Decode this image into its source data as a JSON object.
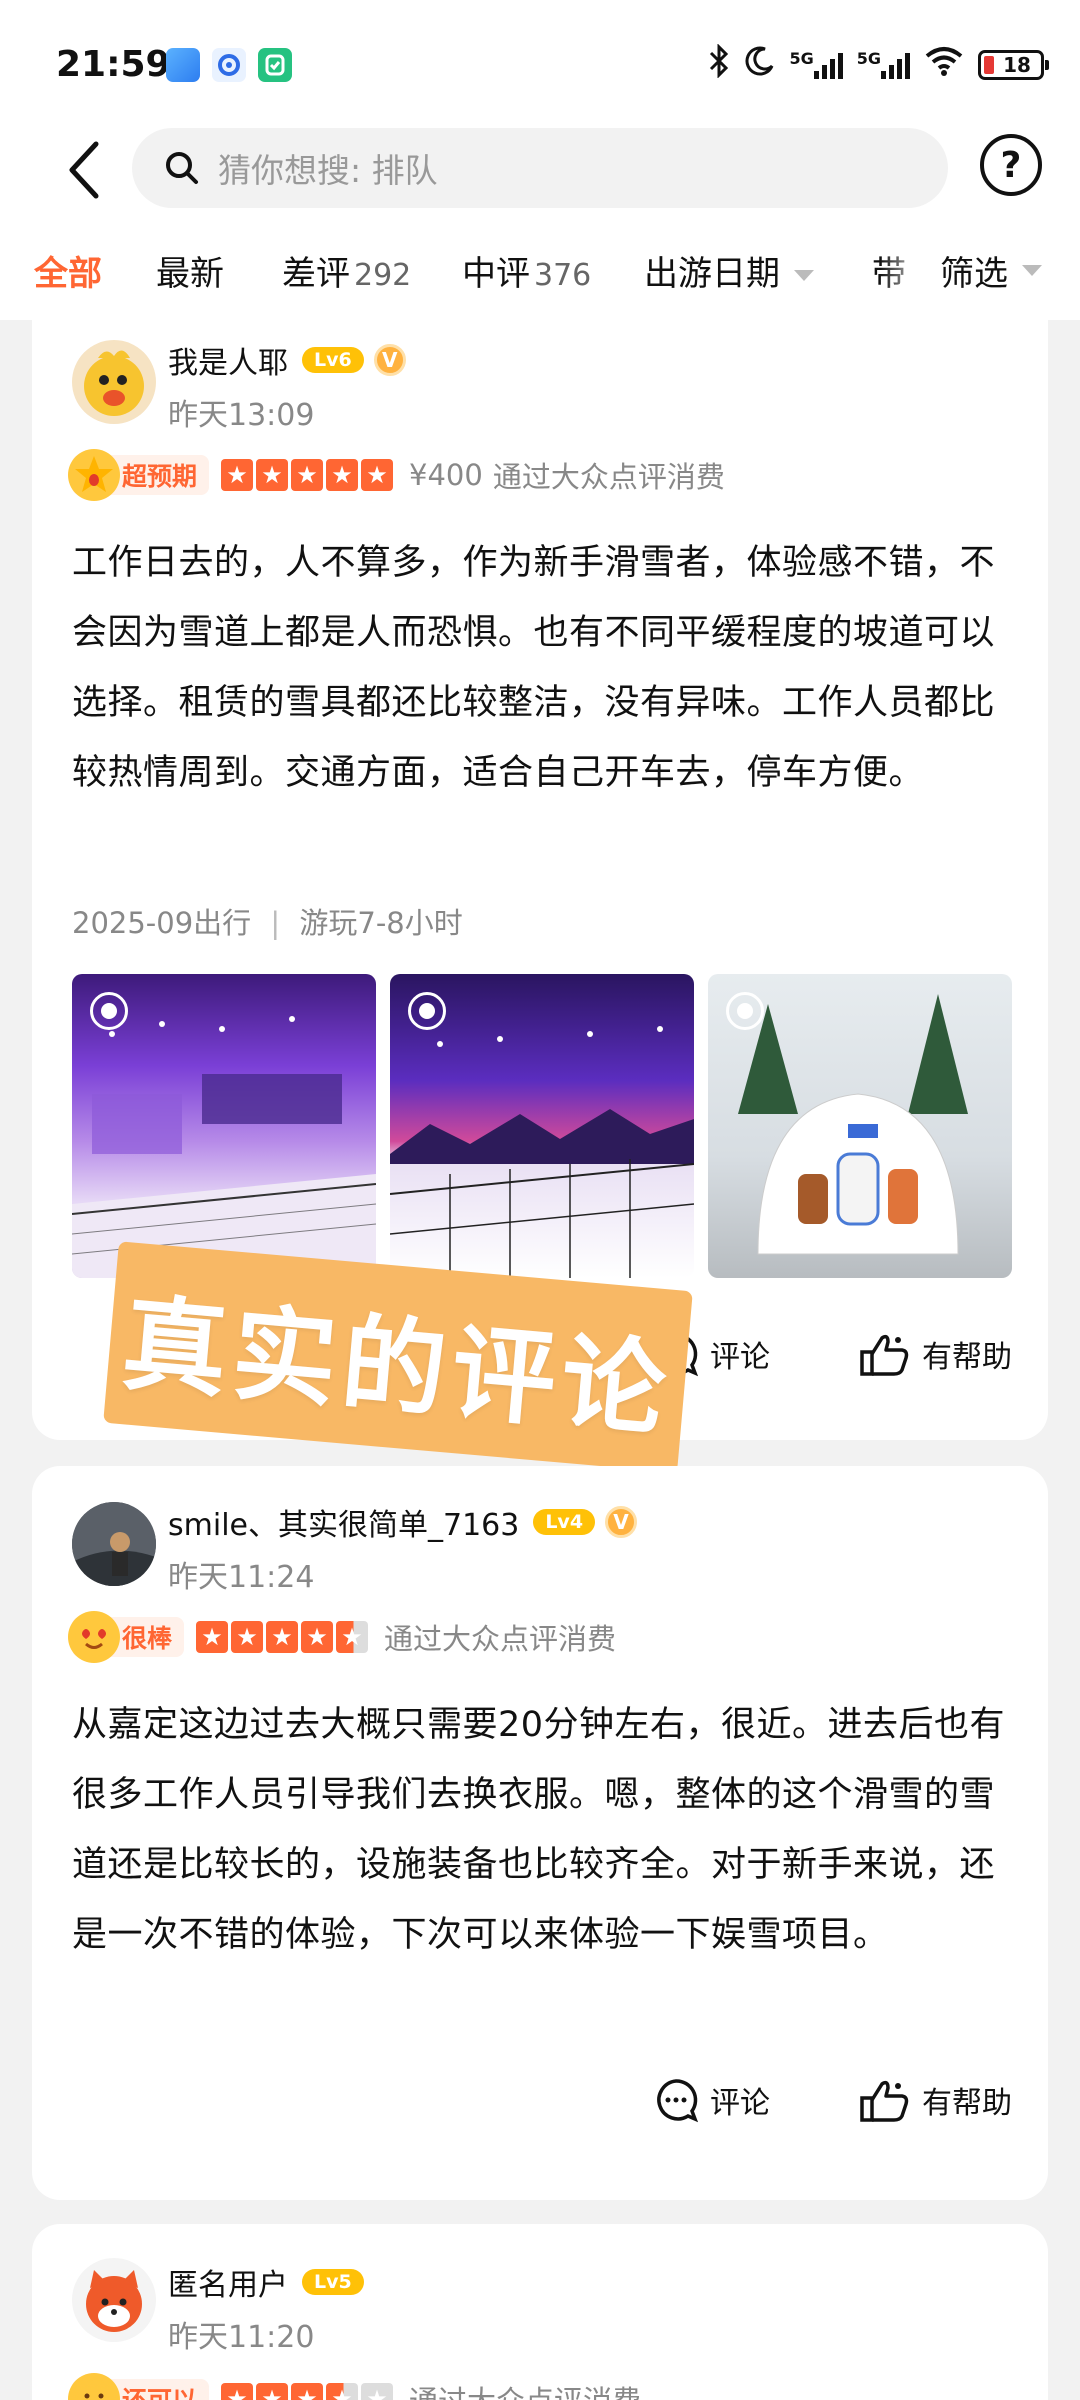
{
  "status_bar": {
    "time": "21:59",
    "network_1": "5G",
    "network_2": "5G",
    "battery": "18"
  },
  "header": {
    "search_placeholder": "猜你想搜: 排队",
    "help_label": "?"
  },
  "tabs": [
    {
      "label": "全部",
      "count": ""
    },
    {
      "label": "最新",
      "count": ""
    },
    {
      "label": "差评",
      "count": "292"
    },
    {
      "label": "中评",
      "count": "376"
    },
    {
      "label": "出游日期",
      "count": ""
    },
    {
      "label": "带图",
      "count": ""
    }
  ],
  "filter_label": "筛选",
  "reviews": [
    {
      "username": "我是人耶",
      "level": "Lv6",
      "verified": "V",
      "time": "昨天13:09",
      "rating_tag": "超预期",
      "rating_value": 5,
      "price": "¥400",
      "source": "通过大众点评消费",
      "text": "工作日去的，人不算多，作为新手滑雪者，体验感不错，不会因为雪道上都是人而恐惧。也有不同平缓程度的坡道可以选择。租赁的雪具都还比较整洁，没有异味。工作人员都比较热情周到。交通方面，适合自己开车去，停车方便。",
      "trip_date": "2025-09出行",
      "duration": "游玩7-8小时",
      "comment_label": "评论",
      "helpful_label": "有帮助"
    },
    {
      "username": "smile、其实很简单_7163",
      "level": "Lv4",
      "verified": "V",
      "time": "昨天11:24",
      "rating_tag": "很棒",
      "rating_value": 4.5,
      "source": "通过大众点评消费",
      "text": "从嘉定这边过去大概只需要20分钟左右，很近。进去后也有很多工作人员引导我们去换衣服。嗯，整体的这个滑雪的雪道还是比较长的，设施装备也比较齐全。对于新手来说，还是一次不错的体验，下次可以来体验一下娱雪项目。",
      "comment_label": "评论",
      "helpful_label": "有帮助"
    },
    {
      "username": "匿名用户",
      "level": "Lv5",
      "time": "昨天11:20",
      "rating_tag": "还可以",
      "rating_value": 3.5,
      "source": "通过大众点评消费"
    }
  ],
  "overlay_stamp": "真实的评论",
  "colors": {
    "accent": "#ff6633",
    "level_badge": "#ffc107",
    "stamp": "#f8b865"
  }
}
